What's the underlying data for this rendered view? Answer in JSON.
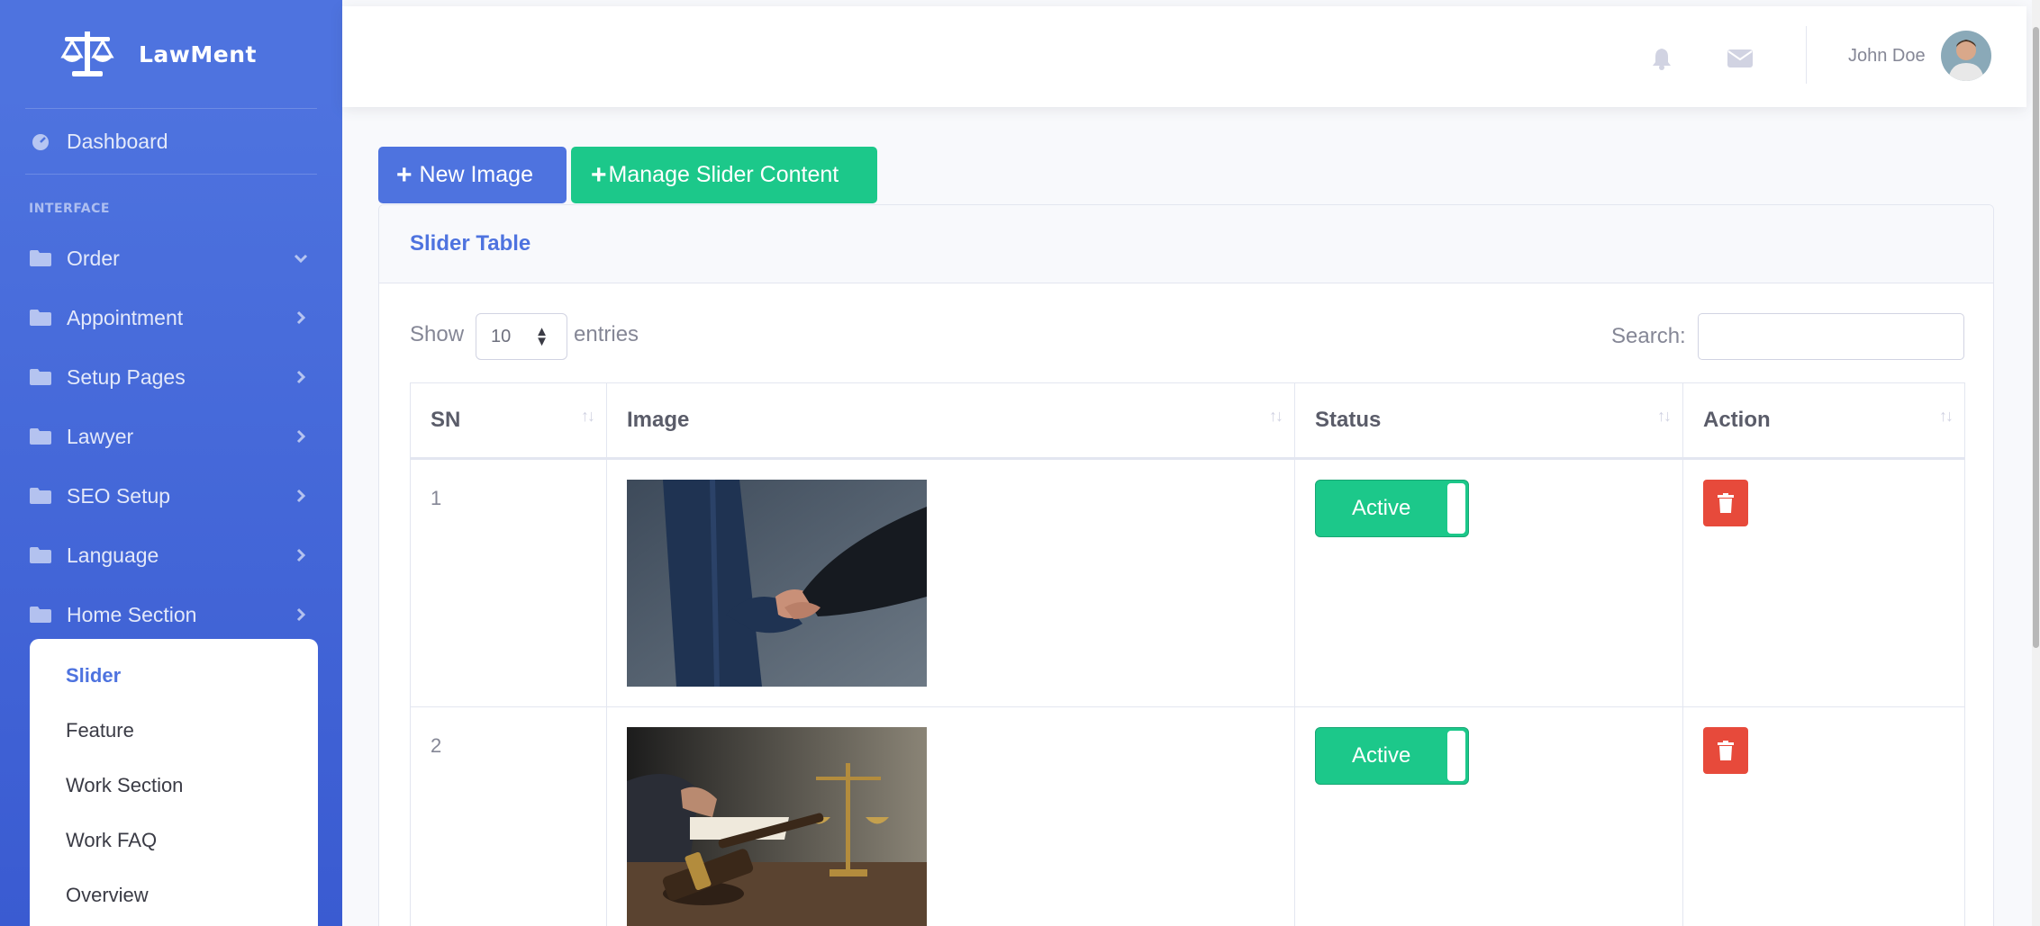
{
  "brand": {
    "name": "LawMent"
  },
  "sidebar": {
    "dashboard": "Dashboard",
    "heading": "INTERFACE",
    "items": [
      {
        "label": "Order",
        "chevron": "down"
      },
      {
        "label": "Appointment",
        "chevron": "right"
      },
      {
        "label": "Setup Pages",
        "chevron": "right"
      },
      {
        "label": "Lawyer",
        "chevron": "right"
      },
      {
        "label": "SEO Setup",
        "chevron": "right"
      },
      {
        "label": "Language",
        "chevron": "right"
      },
      {
        "label": "Home Section",
        "chevron": "right"
      }
    ],
    "submenu": [
      {
        "label": "Slider",
        "active": true
      },
      {
        "label": "Feature"
      },
      {
        "label": "Work Section"
      },
      {
        "label": "Work FAQ"
      },
      {
        "label": "Overview"
      }
    ]
  },
  "topbar": {
    "user_name": "John Doe",
    "icons": [
      "bell-icon",
      "envelope-icon"
    ]
  },
  "actions": {
    "new_image": "New Image",
    "manage_slider": "Manage Slider Content"
  },
  "card": {
    "title": "Slider Table",
    "show_label": "Show",
    "page_length": "10",
    "entries_label": "entries",
    "search_label": "Search:",
    "search_value": ""
  },
  "table": {
    "columns": [
      "SN",
      "Image",
      "Status",
      "Action"
    ],
    "rows": [
      {
        "sn": "1",
        "image": "handshake-photo",
        "status": "Active"
      },
      {
        "sn": "2",
        "image": "gavel-scales-photo",
        "status": "Active"
      }
    ]
  },
  "colors": {
    "primary": "#4e73df",
    "success": "#1cc88a",
    "danger": "#e74a3b"
  }
}
